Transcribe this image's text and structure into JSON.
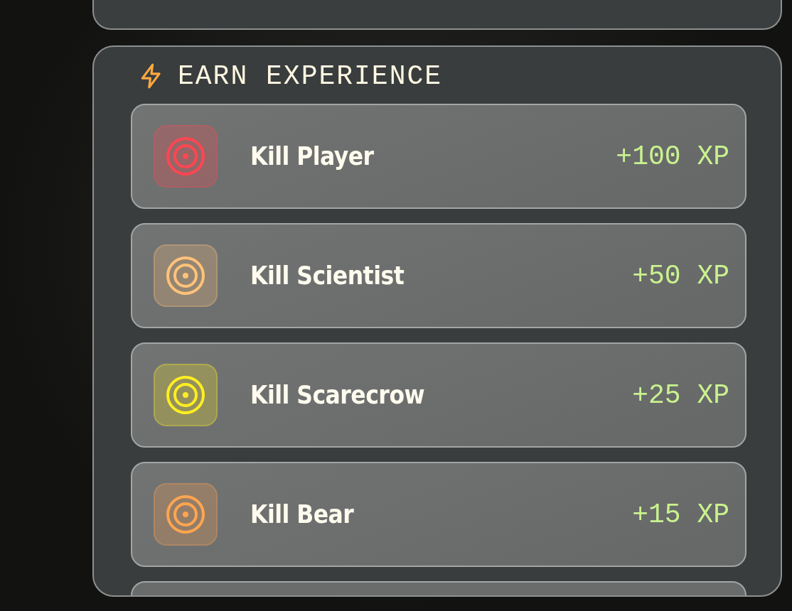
{
  "section": {
    "title": "EARN EXPERIENCE",
    "rows": [
      {
        "label": "Kill Player",
        "reward": "+100 XP",
        "color": "#ff4650"
      },
      {
        "label": "Kill Scientist",
        "reward": "+50 XP",
        "color": "#ffc27a"
      },
      {
        "label": "Kill Scarecrow",
        "reward": "+25 XP",
        "color": "#ffee22"
      },
      {
        "label": "Kill Bear",
        "reward": "+15 XP",
        "color": "#ffa550"
      }
    ]
  }
}
